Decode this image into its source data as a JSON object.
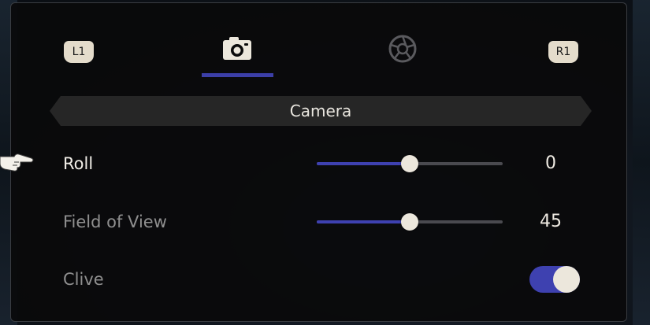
{
  "tabs": {
    "left_shoulder": "L1",
    "right_shoulder": "R1",
    "items": [
      {
        "icon": "camera-icon",
        "selected": true
      },
      {
        "icon": "aperture-filter-icon",
        "selected": false
      }
    ]
  },
  "section": {
    "title": "Camera"
  },
  "settings": [
    {
      "label": "Roll",
      "control": "slider",
      "value_text": "0",
      "level": 0.5,
      "focused": true
    },
    {
      "label": "Field of View",
      "control": "slider",
      "value_text": "45",
      "level": 0.5,
      "focused": false
    },
    {
      "label": "Clive",
      "control": "toggle",
      "on": true,
      "focused": false
    }
  ],
  "colors": {
    "accent": "#3e41b0",
    "panel_bg": "#0a0a0b",
    "text_active": "#f2efe8",
    "text_inactive": "#8f8f8f",
    "knob": "#ece7dc"
  },
  "cursor": {
    "icon": "pointing-hand-icon"
  }
}
